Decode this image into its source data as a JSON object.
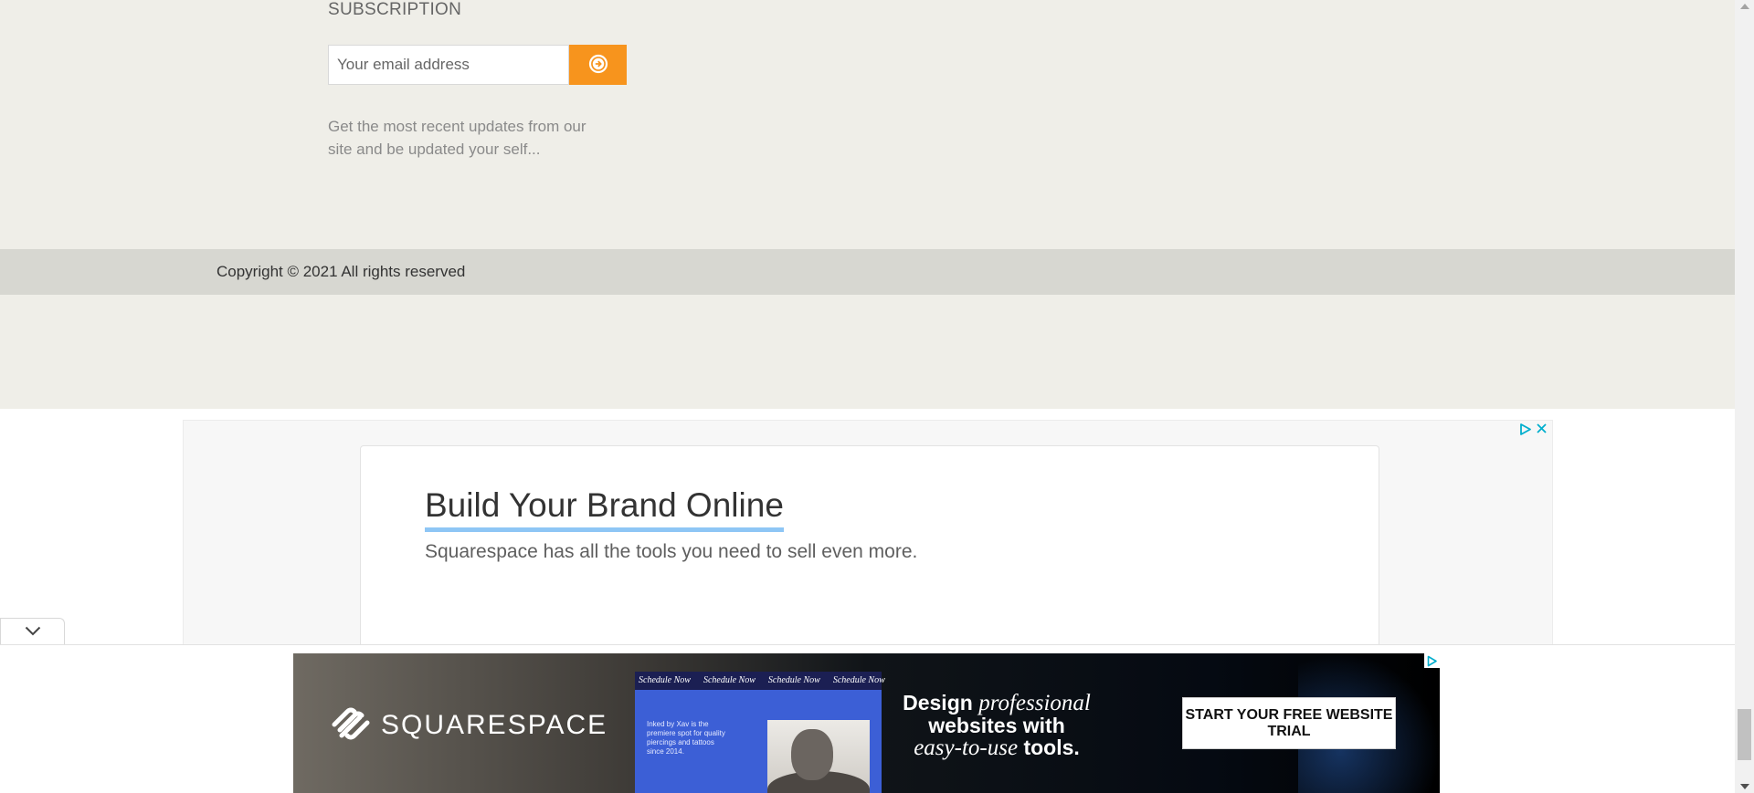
{
  "subscription": {
    "title": "SUBSCRIPTION",
    "email_placeholder": "Your email address",
    "description": "Get the most recent updates from our site and be updated your self..."
  },
  "footer": {
    "copyright": "Copyright © 2021 All rights reserved"
  },
  "ad_display": {
    "headline": "Build Your Brand Online",
    "subtext": "Squarespace has all the tools you need to sell even more."
  },
  "ad_banner": {
    "brand": "SQUARESPACE",
    "phone_nav": [
      "Schedule Now",
      "Schedule Now",
      "Schedule Now",
      "Schedule Now"
    ],
    "phone_blurb": "Inked by Xav is the premiere spot for quality piercings and tattoos since 2014.",
    "tagline_1": "Design",
    "tagline_2": "professional",
    "tagline_3": "websites with",
    "tagline_4": "easy-to-use",
    "tagline_5": "tools.",
    "cta": "START YOUR FREE WEBSITE TRIAL"
  },
  "colors": {
    "footer_bg": "#efeee8",
    "copyright_bg": "#d7d7d1",
    "accent_orange": "#f7941d",
    "underline_blue": "#8ec6f5",
    "adchoices_blue": "#00aecd"
  },
  "icons": {
    "subscribe": "arrow-circle-right-icon",
    "adchoices": "adchoices-icon",
    "close": "close-icon",
    "collapse": "chevron-down-icon"
  }
}
